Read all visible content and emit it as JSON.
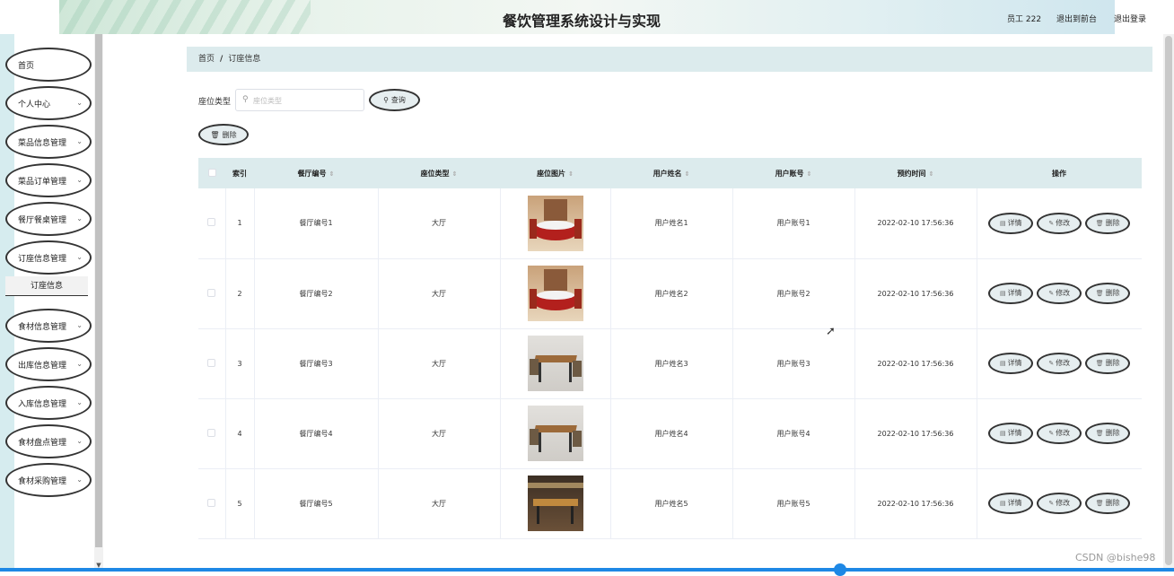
{
  "header": {
    "title": "餐饮管理系统设计与实现",
    "user": "员工 222",
    "front_link": "退出到前台",
    "logout_link": "退出登录"
  },
  "sidebar": {
    "items": [
      {
        "label": "首页",
        "has_chevron": false
      },
      {
        "label": "个人中心",
        "has_chevron": true
      },
      {
        "label": "菜品信息管理",
        "has_chevron": true
      },
      {
        "label": "菜品订单管理",
        "has_chevron": true
      },
      {
        "label": "餐厅餐桌管理",
        "has_chevron": true
      },
      {
        "label": "订座信息管理",
        "has_chevron": true
      },
      {
        "label": "食材信息管理",
        "has_chevron": true
      },
      {
        "label": "出库信息管理",
        "has_chevron": true
      },
      {
        "label": "入库信息管理",
        "has_chevron": true
      },
      {
        "label": "食材盘点管理",
        "has_chevron": true
      },
      {
        "label": "食材采购管理",
        "has_chevron": true
      }
    ],
    "submenu": "订座信息"
  },
  "breadcrumb": {
    "home": "首页",
    "current": "订座信息"
  },
  "search": {
    "label": "座位类型",
    "placeholder": "座位类型",
    "button": "查询"
  },
  "toolbar": {
    "delete": "删除"
  },
  "table": {
    "columns": [
      "索引",
      "餐厅编号",
      "座位类型",
      "座位图片",
      "用户姓名",
      "用户账号",
      "预约时间",
      "操作"
    ],
    "rows": [
      {
        "index": "1",
        "restaurant": "餐厅编号1",
        "seat_type": "大厅",
        "user_name": "用户姓名1",
        "account": "用户账号1",
        "time": "2022-02-10 17:56:36",
        "photo": "round-table-red"
      },
      {
        "index": "2",
        "restaurant": "餐厅编号2",
        "seat_type": "大厅",
        "user_name": "用户姓名2",
        "account": "用户账号2",
        "time": "2022-02-10 17:56:36",
        "photo": "round-table-red"
      },
      {
        "index": "3",
        "restaurant": "餐厅编号3",
        "seat_type": "大厅",
        "user_name": "用户姓名3",
        "account": "用户账号3",
        "time": "2022-02-10 17:56:36",
        "photo": "wood-table-grey"
      },
      {
        "index": "4",
        "restaurant": "餐厅编号4",
        "seat_type": "大厅",
        "user_name": "用户姓名4",
        "account": "用户账号4",
        "time": "2022-02-10 17:56:36",
        "photo": "wood-table-grey"
      },
      {
        "index": "5",
        "restaurant": "餐厅编号5",
        "seat_type": "大厅",
        "user_name": "用户姓名5",
        "account": "用户账号5",
        "time": "2022-02-10 17:56:36",
        "photo": "wood-table-dark"
      }
    ],
    "actions": {
      "detail": "详情",
      "edit": "修改",
      "delete": "删除"
    }
  },
  "watermark": "CSDN @bishe98",
  "colors": {
    "accent": "#dcebed",
    "sidebar_strip": "#d6ecef",
    "taskbar": "#1e88e5"
  }
}
